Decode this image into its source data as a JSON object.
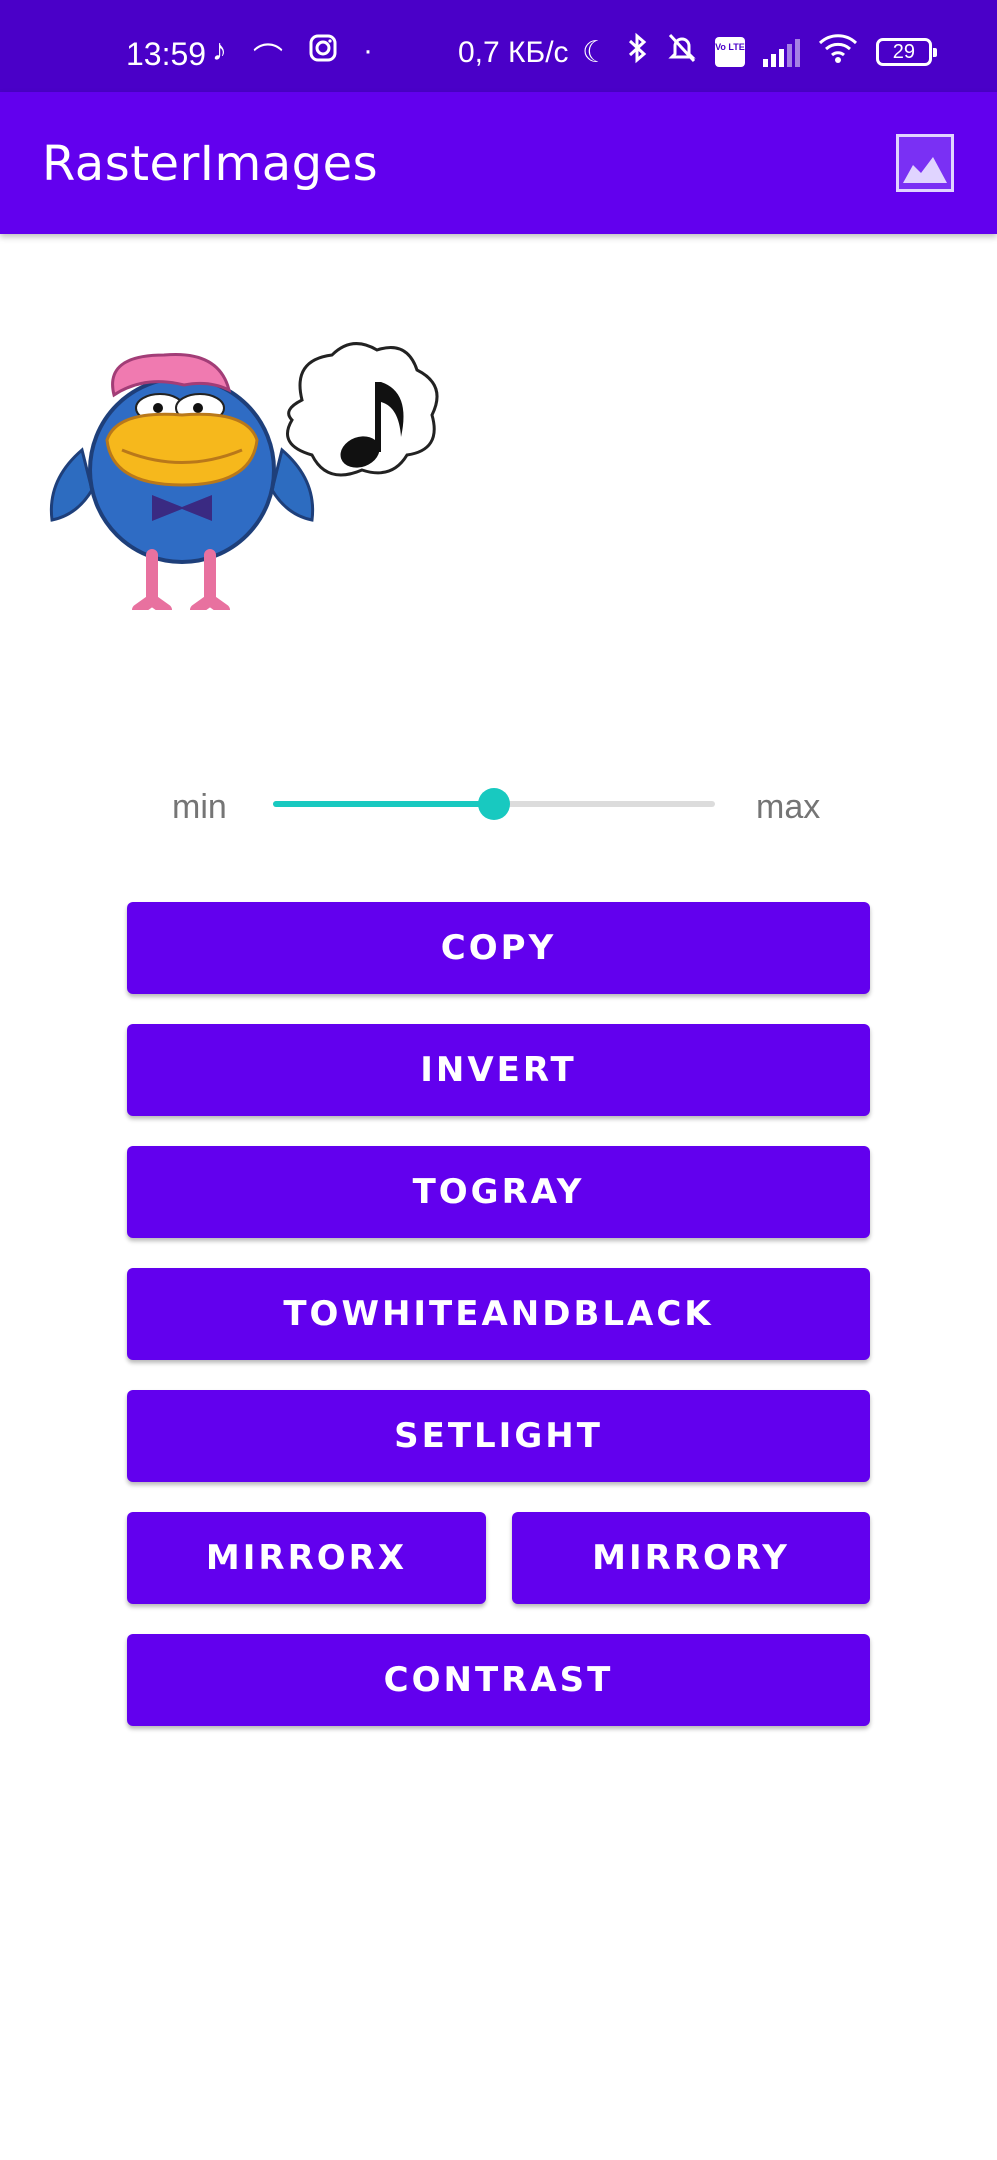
{
  "status_bar": {
    "time": "13:59",
    "net_speed": "0,7 КБ/с",
    "battery_level": "29",
    "volte_label": "Vo LTE",
    "icons_left": [
      "tiktok-icon",
      "arc-icon",
      "instagram-icon",
      "dot-icon"
    ],
    "icons_right": [
      "moon-icon",
      "bluetooth-icon",
      "bell-off-icon",
      "volte-icon",
      "signal-icon",
      "wifi-icon",
      "battery-icon"
    ]
  },
  "app_bar": {
    "title": "RasterImages",
    "action_icon": "image-icon"
  },
  "image": {
    "content": "bird-with-music-note"
  },
  "slider": {
    "min_label": "min",
    "max_label": "max",
    "value_fraction": 0.5
  },
  "buttons": {
    "copy": "COPY",
    "invert": "INVERT",
    "togray": "TOGRAY",
    "towhiteandblack": "TOWHITEANDBLACK",
    "setlight": "SETLIGHT",
    "mirrorx": "MIRRORX",
    "mirrory": "MIRRORY",
    "contrast": "CONTRAST"
  },
  "colors": {
    "status_bar": "#4a00c8",
    "primary": "#6200ee",
    "accent": "#18c9c0",
    "track": "#dcdcdc"
  }
}
